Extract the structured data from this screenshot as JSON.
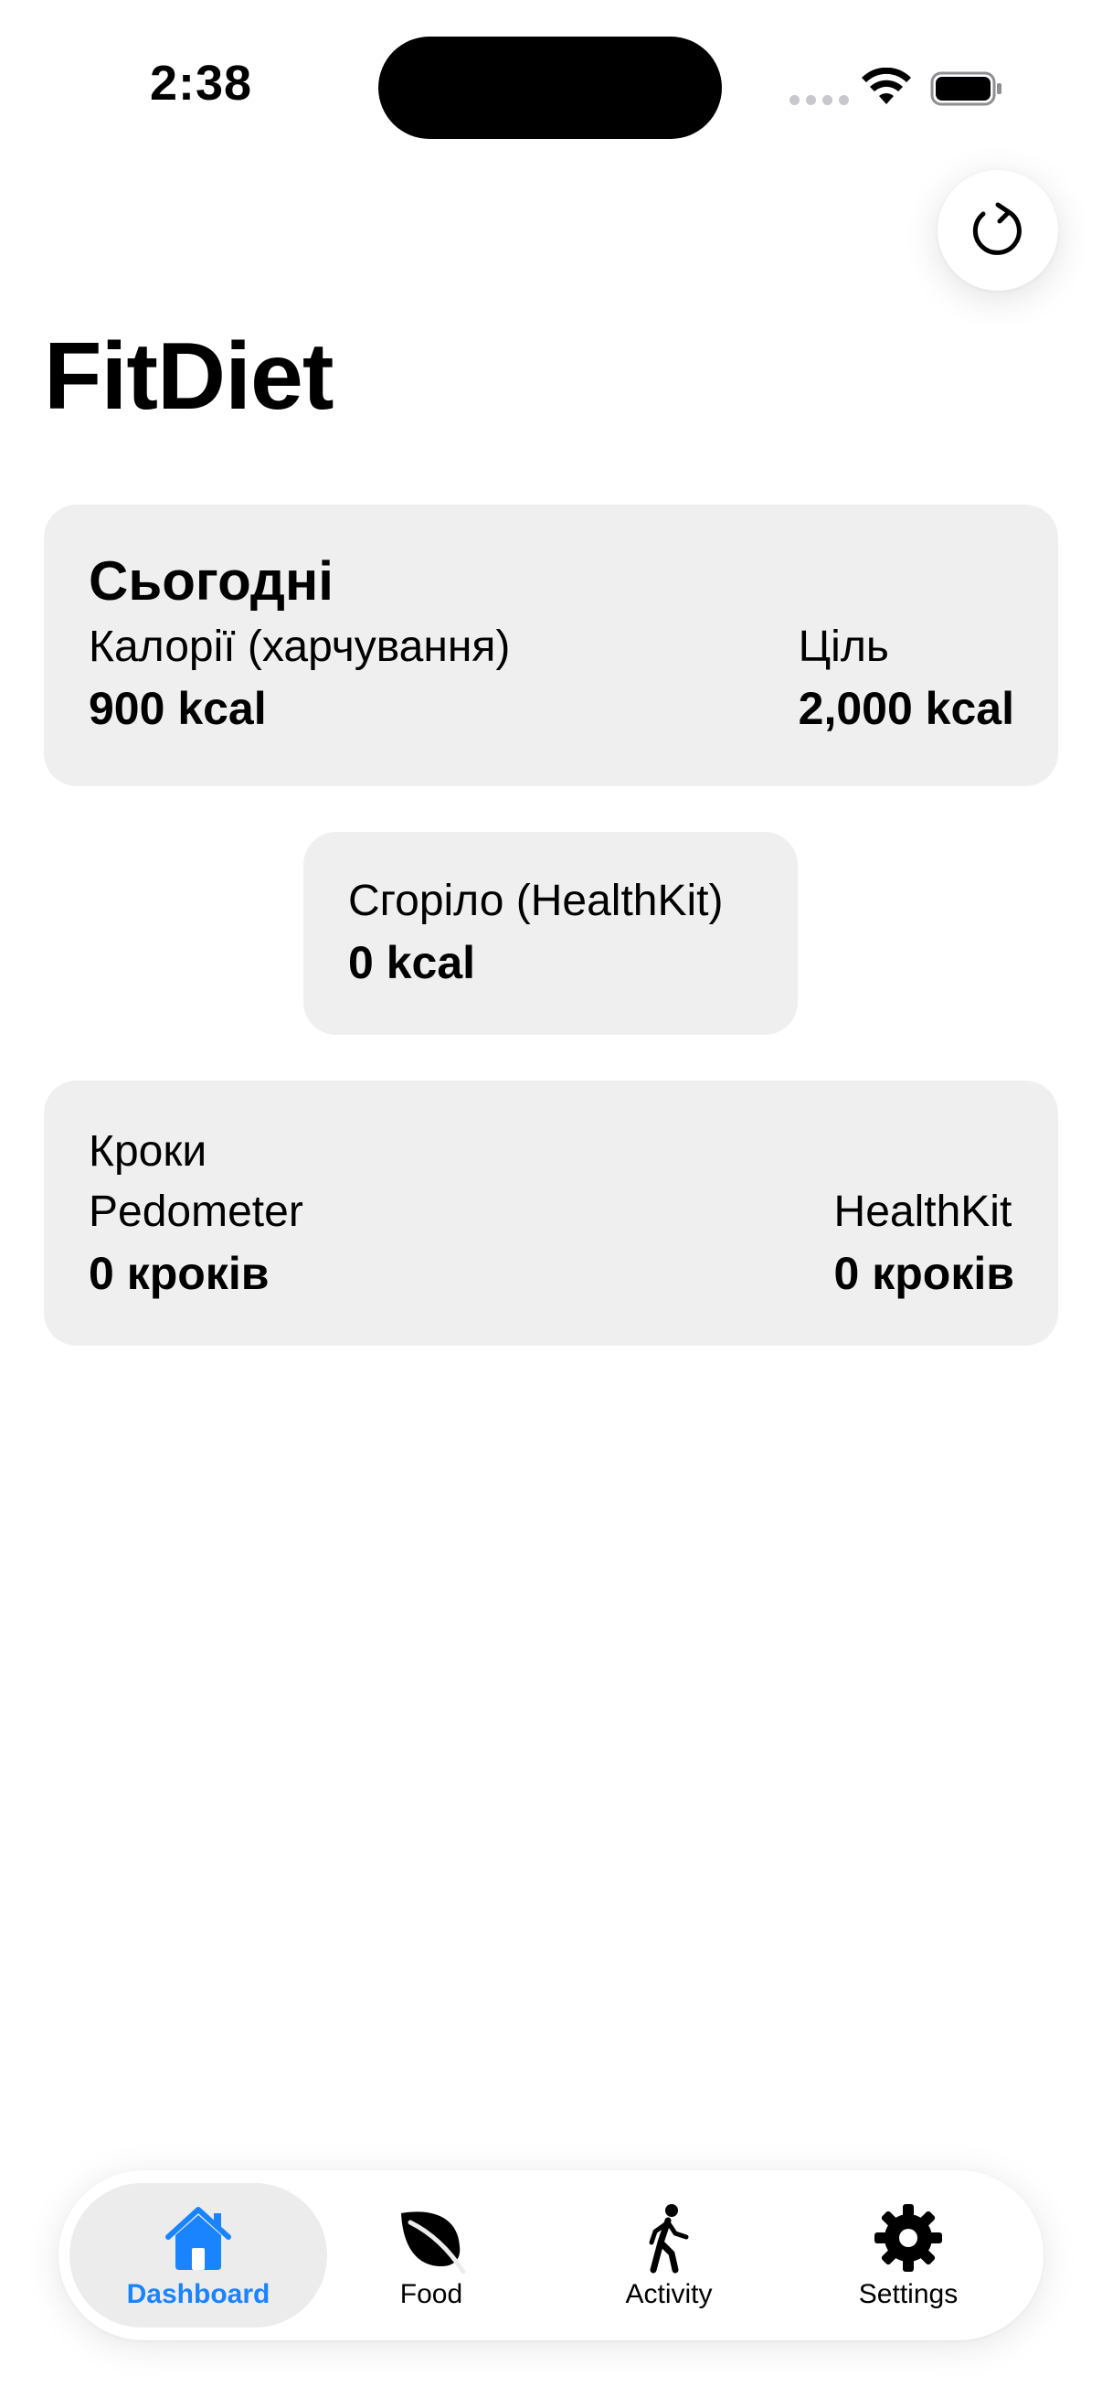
{
  "status_bar": {
    "time": "2:38"
  },
  "app": {
    "title": "FitDiet"
  },
  "today_card": {
    "heading": "Сьогодні",
    "calories_label": "Калорії (харчування)",
    "calories_value": "900 kcal",
    "goal_label": "Ціль",
    "goal_value": "2,000 kcal"
  },
  "burned_card": {
    "label": "Сгоріло (HealthKit)",
    "value": "0 kcal"
  },
  "steps_card": {
    "title": "Кроки",
    "pedometer_label": "Pedometer",
    "pedometer_value": "0 кроків",
    "healthkit_label": "HealthKit",
    "healthkit_value": "0 кроків"
  },
  "tab_bar": {
    "tabs": [
      {
        "label": "Dashboard",
        "icon": "house-icon",
        "active": true
      },
      {
        "label": "Food",
        "icon": "leaf-icon",
        "active": false
      },
      {
        "label": "Activity",
        "icon": "walking-figure-icon",
        "active": false
      },
      {
        "label": "Settings",
        "icon": "gear-icon",
        "active": false
      }
    ]
  },
  "colors": {
    "accent": "#1a84ff",
    "card_background": "#efefef",
    "active_tab_background": "#ececec"
  }
}
